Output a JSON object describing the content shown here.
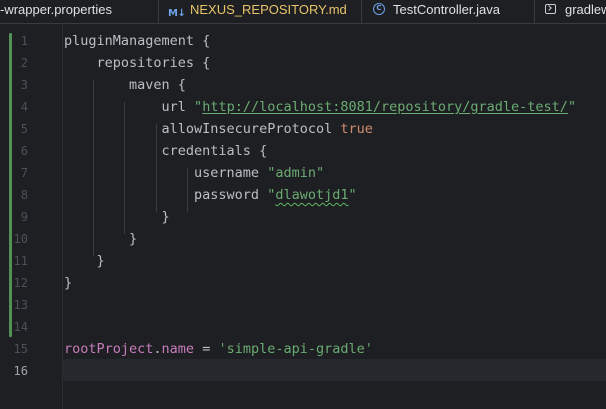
{
  "tabs": [
    {
      "label": "-wrapper.properties",
      "icon": "properties-file-icon",
      "color": "#dfe1e5"
    },
    {
      "label": "NEXUS_REPOSITORY.md",
      "icon": "markdown-file-icon",
      "icon_text": "M↓",
      "color": "#e8c46a"
    },
    {
      "label": "TestController.java",
      "icon": "java-class-icon",
      "icon_text": "C",
      "color": "#dfe1e5"
    },
    {
      "label": "gradlew",
      "icon": "terminal-file-icon",
      "color": "#dfe1e5"
    }
  ],
  "editor": {
    "current_line": 16,
    "line_numbers": [
      "1",
      "2",
      "3",
      "4",
      "5",
      "6",
      "7",
      "8",
      "9",
      "10",
      "11",
      "12",
      "13",
      "14",
      "15",
      "16"
    ],
    "lines": [
      {
        "ln": 1,
        "tokens": [
          {
            "t": "pluginManagement {",
            "c": "op"
          }
        ]
      },
      {
        "ln": 2,
        "tokens": [
          {
            "t": "    repositories {",
            "c": "op"
          }
        ]
      },
      {
        "ln": 3,
        "tokens": [
          {
            "t": "        maven {",
            "c": "op"
          }
        ]
      },
      {
        "ln": 4,
        "tokens": [
          {
            "t": "            url ",
            "c": "op"
          },
          {
            "t": "\"",
            "c": "str"
          },
          {
            "t": "http://localhost:8081/repository/gradle-test/",
            "c": "url"
          },
          {
            "t": "\"",
            "c": "str"
          }
        ]
      },
      {
        "ln": 5,
        "tokens": [
          {
            "t": "            allowInsecureProtocol ",
            "c": "op"
          },
          {
            "t": "true",
            "c": "kw"
          }
        ]
      },
      {
        "ln": 6,
        "tokens": [
          {
            "t": "            credentials {",
            "c": "op"
          }
        ]
      },
      {
        "ln": 7,
        "tokens": [
          {
            "t": "                username ",
            "c": "op"
          },
          {
            "t": "\"admin\"",
            "c": "str"
          }
        ]
      },
      {
        "ln": 8,
        "tokens": [
          {
            "t": "                password ",
            "c": "op"
          },
          {
            "t": "\"",
            "c": "str"
          },
          {
            "t": "dlawotjd1",
            "c": "str typo"
          },
          {
            "t": "\"",
            "c": "str"
          }
        ]
      },
      {
        "ln": 9,
        "tokens": [
          {
            "t": "            }",
            "c": "op"
          }
        ]
      },
      {
        "ln": 10,
        "tokens": [
          {
            "t": "        }",
            "c": "op"
          }
        ]
      },
      {
        "ln": 11,
        "tokens": [
          {
            "t": "    }",
            "c": "op"
          }
        ]
      },
      {
        "ln": 12,
        "tokens": [
          {
            "t": "}",
            "c": "op"
          }
        ]
      },
      {
        "ln": 13,
        "tokens": []
      },
      {
        "ln": 14,
        "tokens": []
      },
      {
        "ln": 15,
        "tokens": [
          {
            "t": "rootProject",
            "c": "prop"
          },
          {
            "t": ".",
            "c": "op"
          },
          {
            "t": "name",
            "c": "prop"
          },
          {
            "t": " = ",
            "c": "op"
          },
          {
            "t": "'simple-api-gradle'",
            "c": "str"
          }
        ]
      },
      {
        "ln": 16,
        "tokens": []
      }
    ]
  },
  "colors": {
    "background": "#1e1f22",
    "string": "#6aab73",
    "keyword": "#cf8e6d",
    "property": "#c77dbb",
    "text": "#bcbec4",
    "vcs_change_bar": "#549159"
  }
}
